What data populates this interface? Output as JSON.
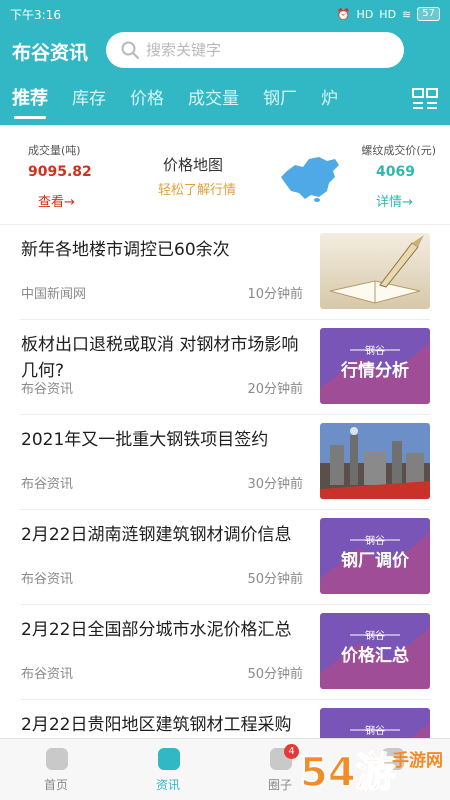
{
  "status_bar": {
    "time": "下午3:16",
    "signal_1": "HD",
    "signal_2": "HD",
    "battery": "57"
  },
  "header": {
    "app_title": "布谷资讯",
    "search_placeholder": "搜索关键字",
    "tabs": [
      {
        "label": "推荐",
        "active": true
      },
      {
        "label": "库存",
        "active": false
      },
      {
        "label": "价格",
        "active": false
      },
      {
        "label": "成交量",
        "active": false
      },
      {
        "label": "钢厂",
        "active": false
      },
      {
        "label": "炉",
        "active": false
      }
    ],
    "grid_icon": "grid-menu-icon"
  },
  "summary": {
    "volume_label": "成交量(吨)",
    "volume_value": "9095.82",
    "volume_link": "查看→",
    "map_title": "价格地图",
    "map_subtitle": "轻松了解行情",
    "price_label": "螺纹成交价(元)",
    "price_value": "4069",
    "price_link": "详情→"
  },
  "news": [
    {
      "title": "新年各地楼市调控已60余次",
      "source": "中国新闻网",
      "time": "10分钟前",
      "thumb_type": "pen-book"
    },
    {
      "title": "板材出口退税或取消 对钢材市场影响几何?",
      "source": "布谷资讯",
      "time": "20分钟前",
      "thumb_type": "banner",
      "thumb_brand": "钢谷",
      "thumb_text": "行情分析"
    },
    {
      "title": "2021年又一批重大钢铁项目签约",
      "source": "布谷资讯",
      "time": "30分钟前",
      "thumb_type": "steel-plant"
    },
    {
      "title": "2月22日湖南涟钢建筑钢材调价信息",
      "source": "布谷资讯",
      "time": "50分钟前",
      "thumb_type": "banner",
      "thumb_brand": "钢谷",
      "thumb_text": "钢厂调价"
    },
    {
      "title": "2月22日全国部分城市水泥价格汇总",
      "source": "布谷资讯",
      "time": "50分钟前",
      "thumb_type": "banner",
      "thumb_brand": "钢谷",
      "thumb_text": "价格汇总"
    },
    {
      "title": "2月22日贵阳地区建筑钢材工程采购",
      "source": "",
      "time": "",
      "thumb_type": "banner",
      "thumb_brand": "钢谷",
      "thumb_text": ""
    }
  ],
  "bottom_nav": [
    {
      "label": "首页",
      "active": false,
      "badge": ""
    },
    {
      "label": "资讯",
      "active": true,
      "badge": ""
    },
    {
      "label": "圈子",
      "active": false,
      "badge": "4"
    },
    {
      "label": "",
      "active": false,
      "badge": ""
    }
  ],
  "watermark": {
    "text": "54游",
    "url_text": "手游网"
  },
  "colors": {
    "brand": "#32b8c4",
    "red": "#d0311a",
    "teal": "#31b7b0",
    "orange": "#e0a23b"
  }
}
